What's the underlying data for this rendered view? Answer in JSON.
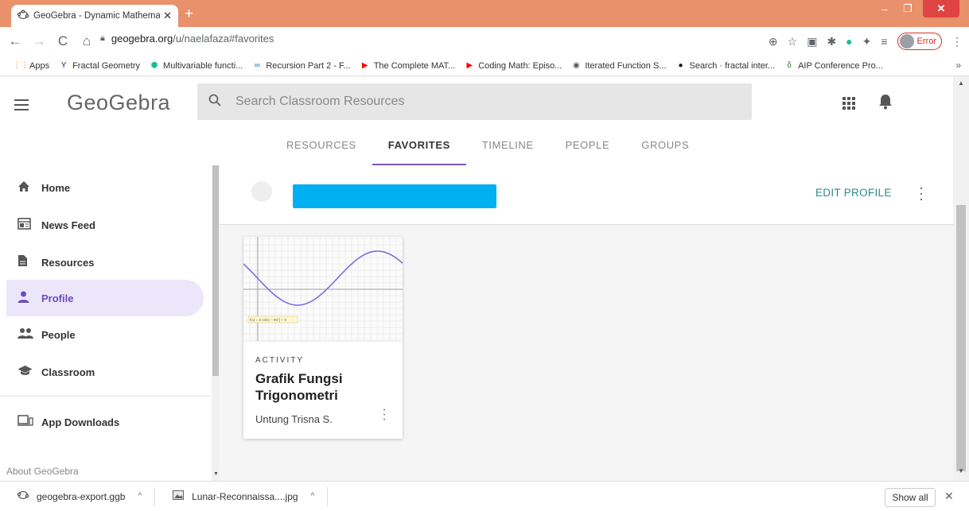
{
  "browser": {
    "tab_title": "GeoGebra - Dynamic Mathemati",
    "tab_close": "✕",
    "new_tab": "+",
    "url_host": "geogebra.org",
    "url_path": "/u/naelafaza#favorites",
    "profile_status": "Error",
    "win_min": "–",
    "win_max": "❐",
    "win_close": "✕",
    "bookmarks": [
      {
        "label": "Apps",
        "icon": "apps-grid-icon",
        "color": "#e8710a"
      },
      {
        "label": "Fractal Geometry",
        "icon": "yale-y-icon",
        "color": "#1a237e"
      },
      {
        "label": "Multivariable functi...",
        "icon": "khan-icon",
        "color": "#14bf96"
      },
      {
        "label": "Recursion Part 2 - F...",
        "icon": "codecademy-icon",
        "color": "#1565c0"
      },
      {
        "label": "The Complete MAT...",
        "icon": "youtube-icon",
        "color": "#ff0000"
      },
      {
        "label": "Coding Math: Episo...",
        "icon": "youtube-icon",
        "color": "#ff0000"
      },
      {
        "label": "Iterated Function S...",
        "icon": "globe-icon",
        "color": "#555555"
      },
      {
        "label": "Search · fractal inter...",
        "icon": "github-icon",
        "color": "#111111"
      },
      {
        "label": "AIP Conference Pro...",
        "icon": "aip-icon",
        "color": "#2e7d32"
      }
    ],
    "bookmarks_more": "»"
  },
  "header": {
    "logo": "GeoGebra",
    "search_placeholder": "Search Classroom Resources",
    "tabs": [
      {
        "label": "RESOURCES",
        "active": false
      },
      {
        "label": "FAVORITES",
        "active": true
      },
      {
        "label": "TIMELINE",
        "active": false
      },
      {
        "label": "PEOPLE",
        "active": false
      },
      {
        "label": "GROUPS",
        "active": false
      }
    ]
  },
  "sidebar": {
    "items": [
      {
        "label": "Home",
        "icon": "home-icon",
        "active": false
      },
      {
        "label": "News Feed",
        "icon": "news-feed-icon",
        "active": false
      },
      {
        "label": "Resources",
        "icon": "file-icon",
        "active": false
      },
      {
        "label": "Profile",
        "icon": "person-icon",
        "active": true
      },
      {
        "label": "People",
        "icon": "people-icon",
        "active": false
      },
      {
        "label": "Classroom",
        "icon": "graduation-cap-icon",
        "active": false
      }
    ],
    "app_downloads": "App Downloads",
    "about": "About GeoGebra"
  },
  "profile": {
    "edit_label": "EDIT PROFILE"
  },
  "cards": [
    {
      "type": "ACTIVITY",
      "title": "Grafik Fungsi Trigonometri",
      "author": "Untung Trisna S.",
      "thumbnail_formula": "f(x) = 2 sin(x − 90°) + 0"
    }
  ],
  "downloads": [
    {
      "filename": "geogebra-export.ggb",
      "icon": "geogebra-file-icon"
    },
    {
      "filename": "Lunar-Reconnaissa....jpg",
      "icon": "image-file-icon"
    }
  ],
  "downloads_show_all": "Show all",
  "downloads_close": "✕",
  "colors": {
    "titlebar": "#e8916a",
    "accent_purple": "#7e57c2",
    "teal": "#2e8b86",
    "redaction": "#00b0f0"
  }
}
